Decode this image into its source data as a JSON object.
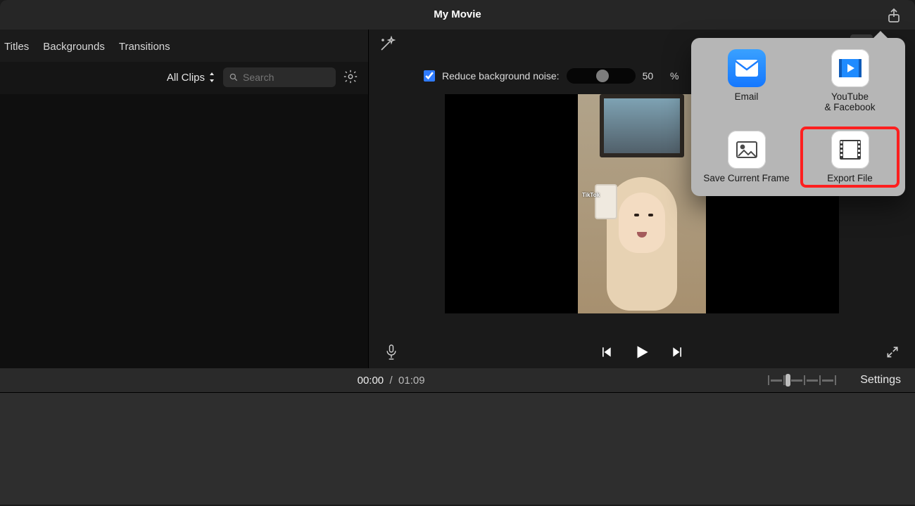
{
  "title": "My Movie",
  "tabs": {
    "titles": "Titles",
    "backgrounds": "Backgrounds",
    "transitions": "Transitions"
  },
  "filter": {
    "all_clips": "All Clips",
    "search_placeholder": "Search"
  },
  "noise": {
    "label": "Reduce background noise:",
    "value": "50",
    "unit": "%"
  },
  "time": {
    "current": "00:00",
    "sep": "/",
    "total": "01:09"
  },
  "settings_label": "Settings",
  "share": {
    "email": "Email",
    "youtube": "YouTube\n& Facebook",
    "save_frame": "Save Current Frame",
    "export_file": "Export File"
  },
  "video_overlay": {
    "tiktok": "TikTok"
  }
}
